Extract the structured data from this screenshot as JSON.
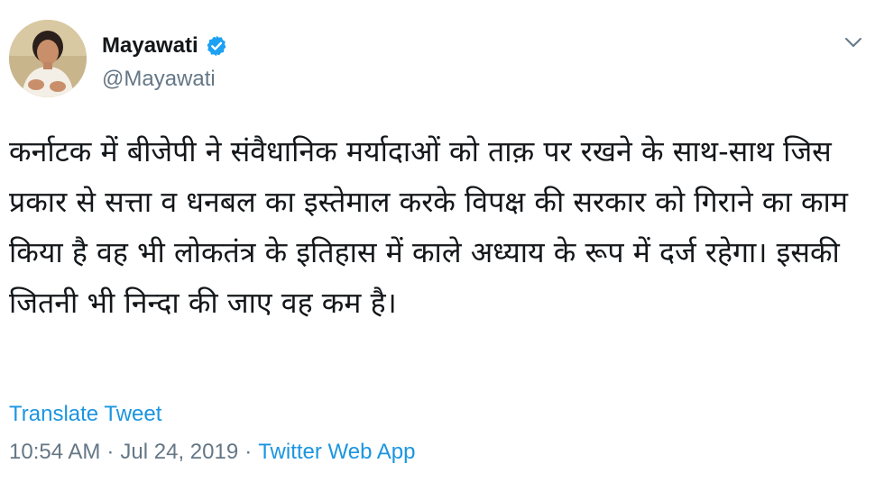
{
  "author": {
    "display_name": "Mayawati",
    "handle": "@Mayawati",
    "verified": true,
    "avatar_icon": "profile-photo"
  },
  "tweet": {
    "text": "कर्नाटक में बीजेपी ने संवैधानिक मर्यादाओं को ताक़ पर रखने के साथ-साथ जिस प्रकार से सत्ता व धनबल का इस्तेमाल करके विपक्ष की सरकार को गिराने का काम किया है वह भी लोकतंत्र के इतिहास में काले अध्याय के रूप में दर्ज रहेगा। इसकी जितनी भी निन्दा की जाए वह कम है।",
    "translate_label": "Translate Tweet",
    "time": "10:54 AM",
    "separator": "·",
    "date": "Jul 24, 2019",
    "source": "Twitter Web App"
  },
  "icons": {
    "verified": "verified-badge-icon",
    "caret": "chevron-down-icon"
  },
  "colors": {
    "text": "#14171a",
    "secondary": "#657786",
    "link": "#1b95e0",
    "verified": "#1da1f2"
  }
}
